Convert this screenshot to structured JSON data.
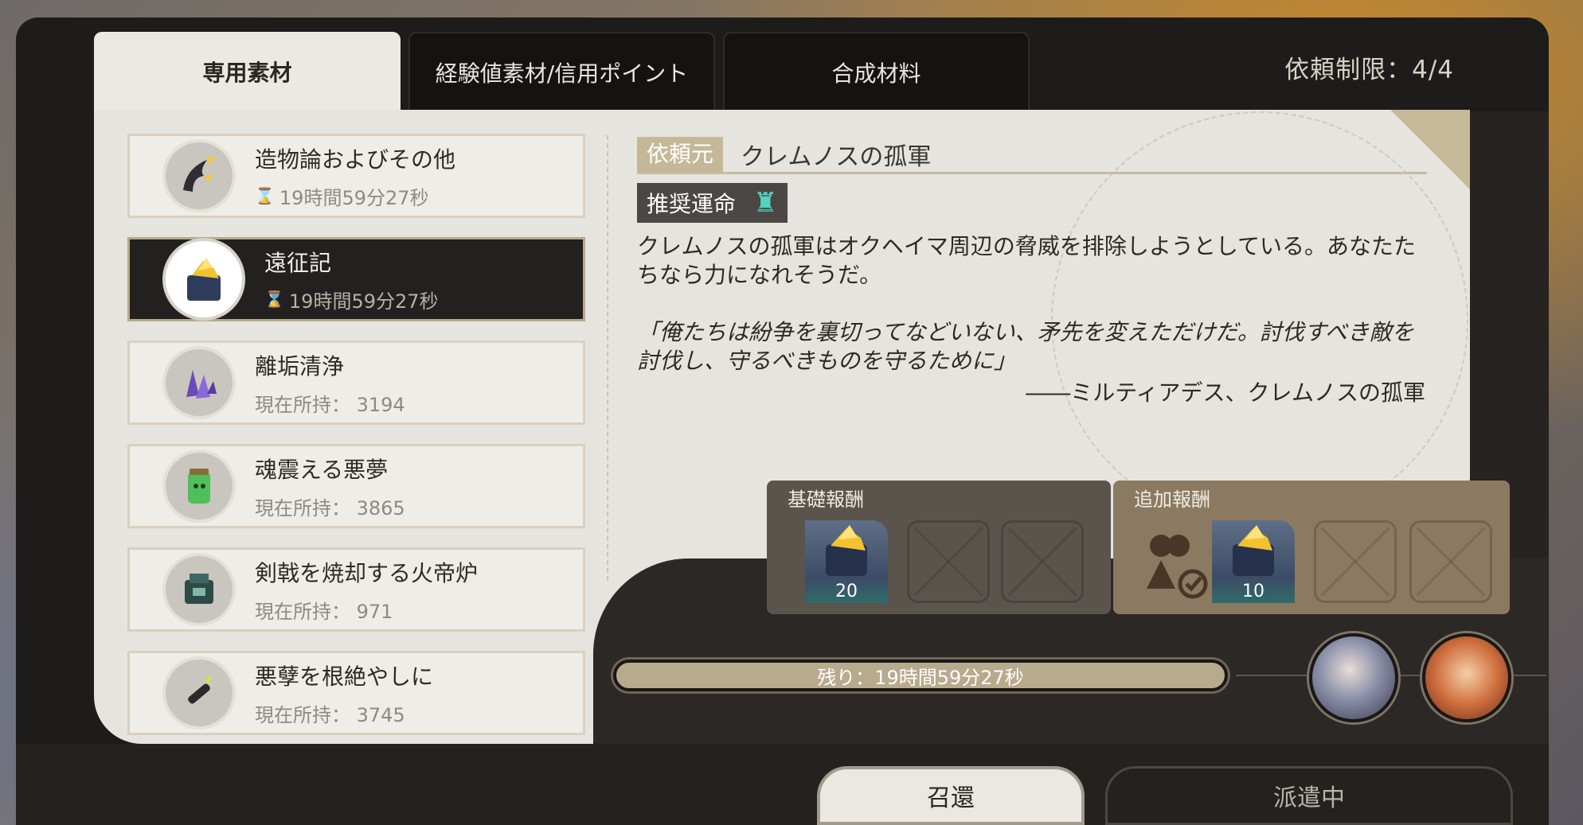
{
  "tabs": [
    {
      "label": "専用素材"
    },
    {
      "label": "経験値素材/信用ポイント"
    },
    {
      "label": "合成材料"
    }
  ],
  "limit_text": "依頼制限：4/4",
  "list": [
    {
      "name": "造物論およびその他",
      "sub": "19時間59分27秒",
      "sub_icon": "hourglass-icon",
      "icon": "horn-crown-icon",
      "selected": false
    },
    {
      "name": "遠征記",
      "sub": "19時間59分27秒",
      "sub_icon": "hourglass-icon",
      "icon": "gold-ore-crate-icon",
      "selected": true
    },
    {
      "name": "離垢清浄",
      "sub": "現在所持： 3194",
      "icon": "purple-crystal-icon",
      "selected": false
    },
    {
      "name": "魂震える悪夢",
      "sub": "現在所持： 3865",
      "icon": "green-canister-icon",
      "selected": false
    },
    {
      "name": "剣戟を焼却する火帝炉",
      "sub": "現在所持： 971",
      "icon": "teal-furnace-icon",
      "selected": false
    },
    {
      "name": "悪孽を根絶やしに",
      "sub": "現在所持： 3745",
      "icon": "scroll-quill-icon",
      "selected": false
    }
  ],
  "detail": {
    "requester_label": "依頼元",
    "requester_value": "クレムノスの孤軍",
    "path_label": "推奨運命",
    "path_icon": "destruction-path-icon",
    "description": "クレムノスの孤軍はオクヘイマ周辺の脅威を排除しようとしている。あなたたちなら力になれそうだ。",
    "quote": "「俺たちは紛争を裏切ってなどいない、矛先を変えただけだ。討伐すべき敵を討伐し、守るべきものを守るために」",
    "quote_author": "――ミルティアデス、クレムノスの孤軍"
  },
  "rewards": {
    "base_title": "基礎報酬",
    "base_count": "20",
    "extra_title": "追加報酬",
    "extra_count": "10",
    "item_icon": "gold-ore-crate-icon",
    "extra_condition_icon": "friends-check-icon"
  },
  "timer_text": "残り：19時間59分27秒",
  "avatars": [
    {
      "icon": "silver-haired-character-avatar"
    },
    {
      "icon": "orange-haired-character-avatar"
    }
  ],
  "buttons": {
    "recall": "召還",
    "dispatching": "派遣中"
  },
  "colors": {
    "accent_teal": "#53d3c0",
    "tag_gold": "#c5b898",
    "selected_dark": "#23211f"
  }
}
